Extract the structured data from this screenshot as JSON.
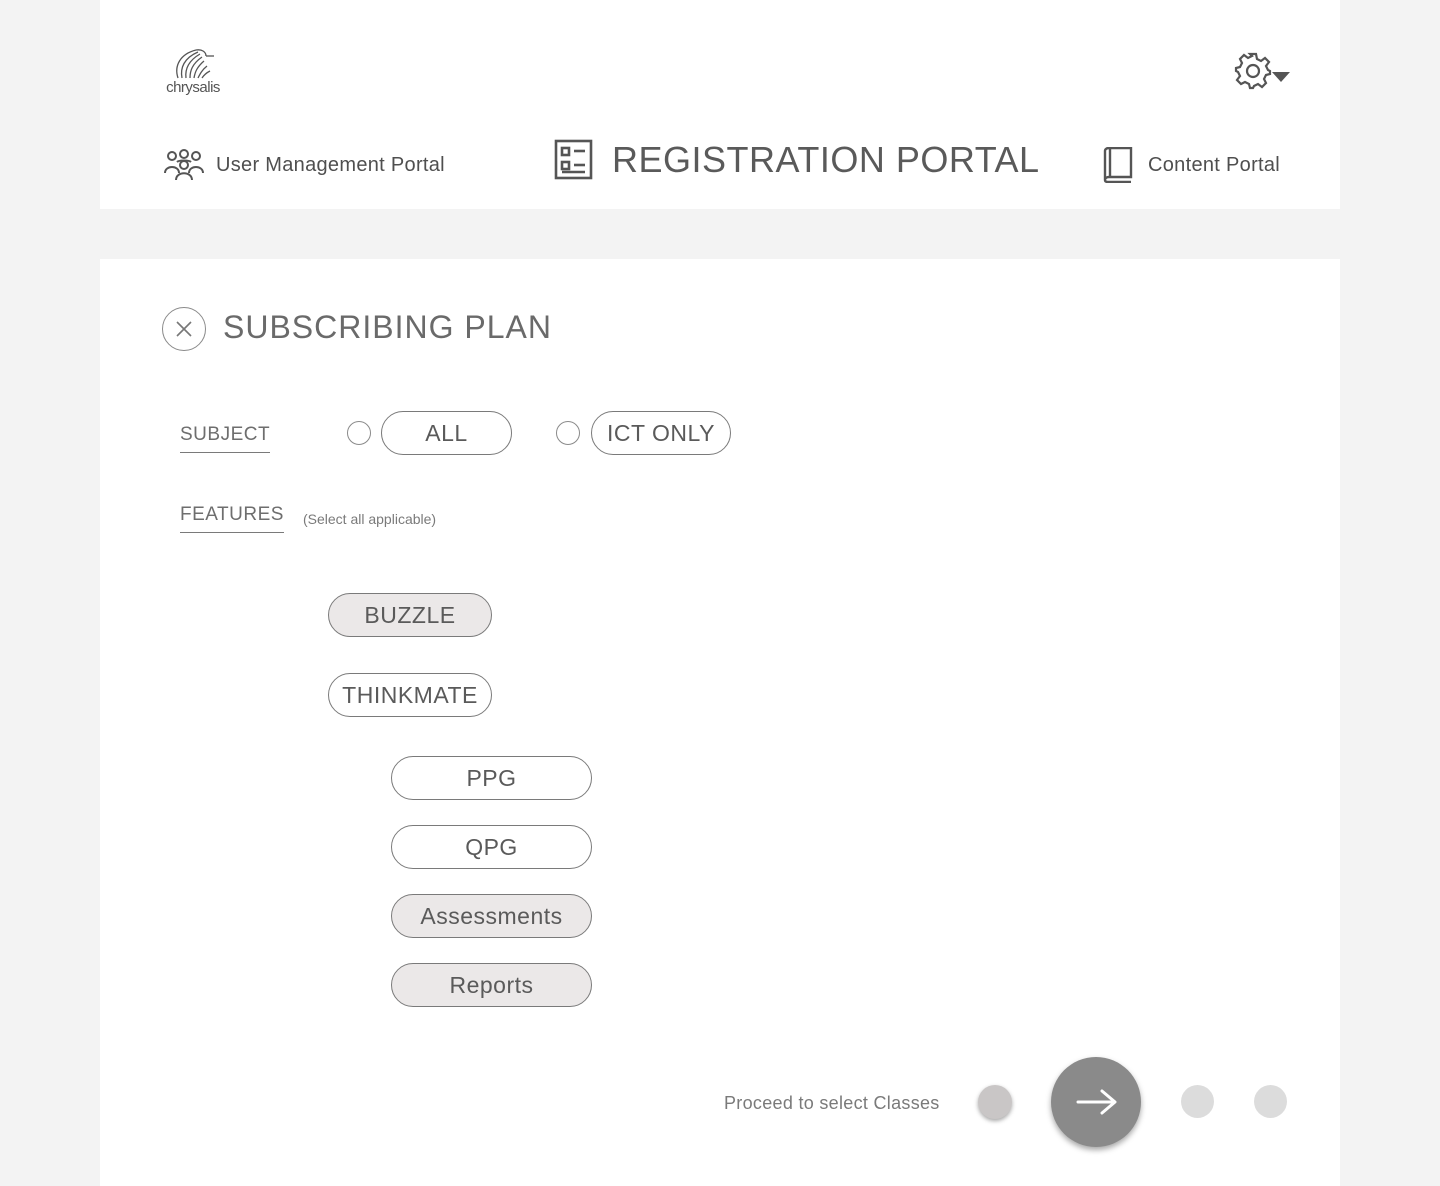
{
  "header": {
    "logo_text": "chrysalis",
    "settings_icon": "gear-icon",
    "nav": {
      "user_management": "User Management Portal",
      "registration": "REGISTRATION PORTAL",
      "content": "Content Portal"
    }
  },
  "main": {
    "title": "SUBSCRIBING PLAN",
    "subject": {
      "label": "SUBJECT",
      "options": [
        {
          "label": "ALL",
          "checked": false
        },
        {
          "label": "ICT ONLY",
          "checked": false
        }
      ]
    },
    "features": {
      "label": "FEATURES",
      "hint": "(Select all applicable)",
      "items": [
        {
          "label": "BUZZLE",
          "selected": true
        },
        {
          "label": "THINKMATE",
          "selected": false
        },
        {
          "label": "PPG",
          "selected": false
        },
        {
          "label": "QPG",
          "selected": false
        },
        {
          "label": "Assessments",
          "selected": true
        },
        {
          "label": "Reports",
          "selected": true
        }
      ]
    },
    "footer": {
      "proceed_text": "Proceed to select Classes",
      "steps": 4,
      "current_step": 1
    }
  },
  "colors": {
    "background": "#f3f3f3",
    "panel": "#ffffff",
    "text": "#5f5f5f",
    "selected_fill": "#ebe8e8",
    "next_button": "#8a8a8a"
  }
}
